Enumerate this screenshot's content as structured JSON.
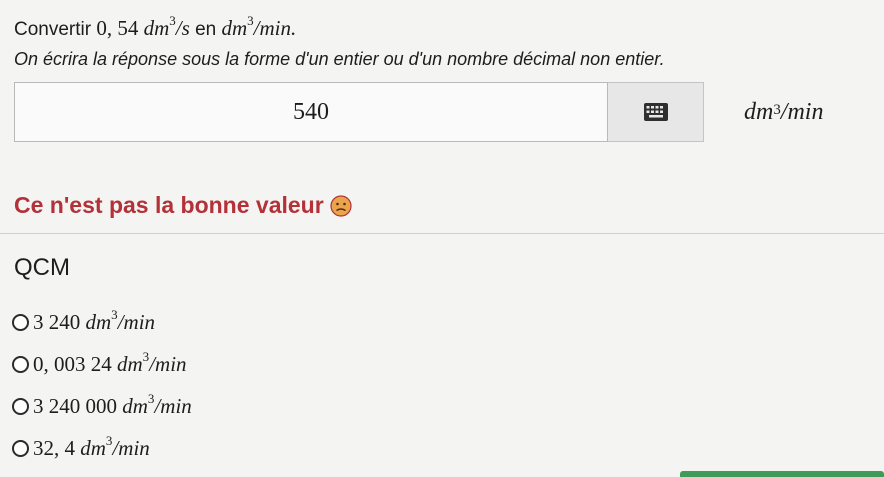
{
  "question": {
    "prefix": "Convertir",
    "value": "0, 54",
    "from_base": "dm",
    "from_exp": "3",
    "from_rate": "/s",
    "connector": "en",
    "to_base": "dm",
    "to_exp": "3",
    "to_rate": "/min."
  },
  "instruction": "On écrira la réponse sous la forme d'un entier ou d'un nombre décimal non entier.",
  "answer": {
    "value": "540",
    "unit_base": "dm",
    "unit_exp": "3",
    "unit_rate": "/min"
  },
  "feedback": {
    "text": "Ce n'est pas la bonne valeur",
    "color": "#b3323a"
  },
  "qcm": {
    "title": "QCM",
    "options": [
      {
        "number": "3 240",
        "base": "dm",
        "exp": "3",
        "rate": "/min"
      },
      {
        "number": "0, 003 24",
        "base": "dm",
        "exp": "3",
        "rate": "/min"
      },
      {
        "number": "3 240 000",
        "base": "dm",
        "exp": "3",
        "rate": "/min"
      },
      {
        "number": "32, 4",
        "base": "dm",
        "exp": "3",
        "rate": "/min"
      }
    ]
  },
  "icons": {
    "keyboard": "keyboard-icon",
    "feedback": "sad-face-icon"
  },
  "colors": {
    "accent_bar": "#3f9b57",
    "feedback_emoji": "#e8a54b"
  }
}
